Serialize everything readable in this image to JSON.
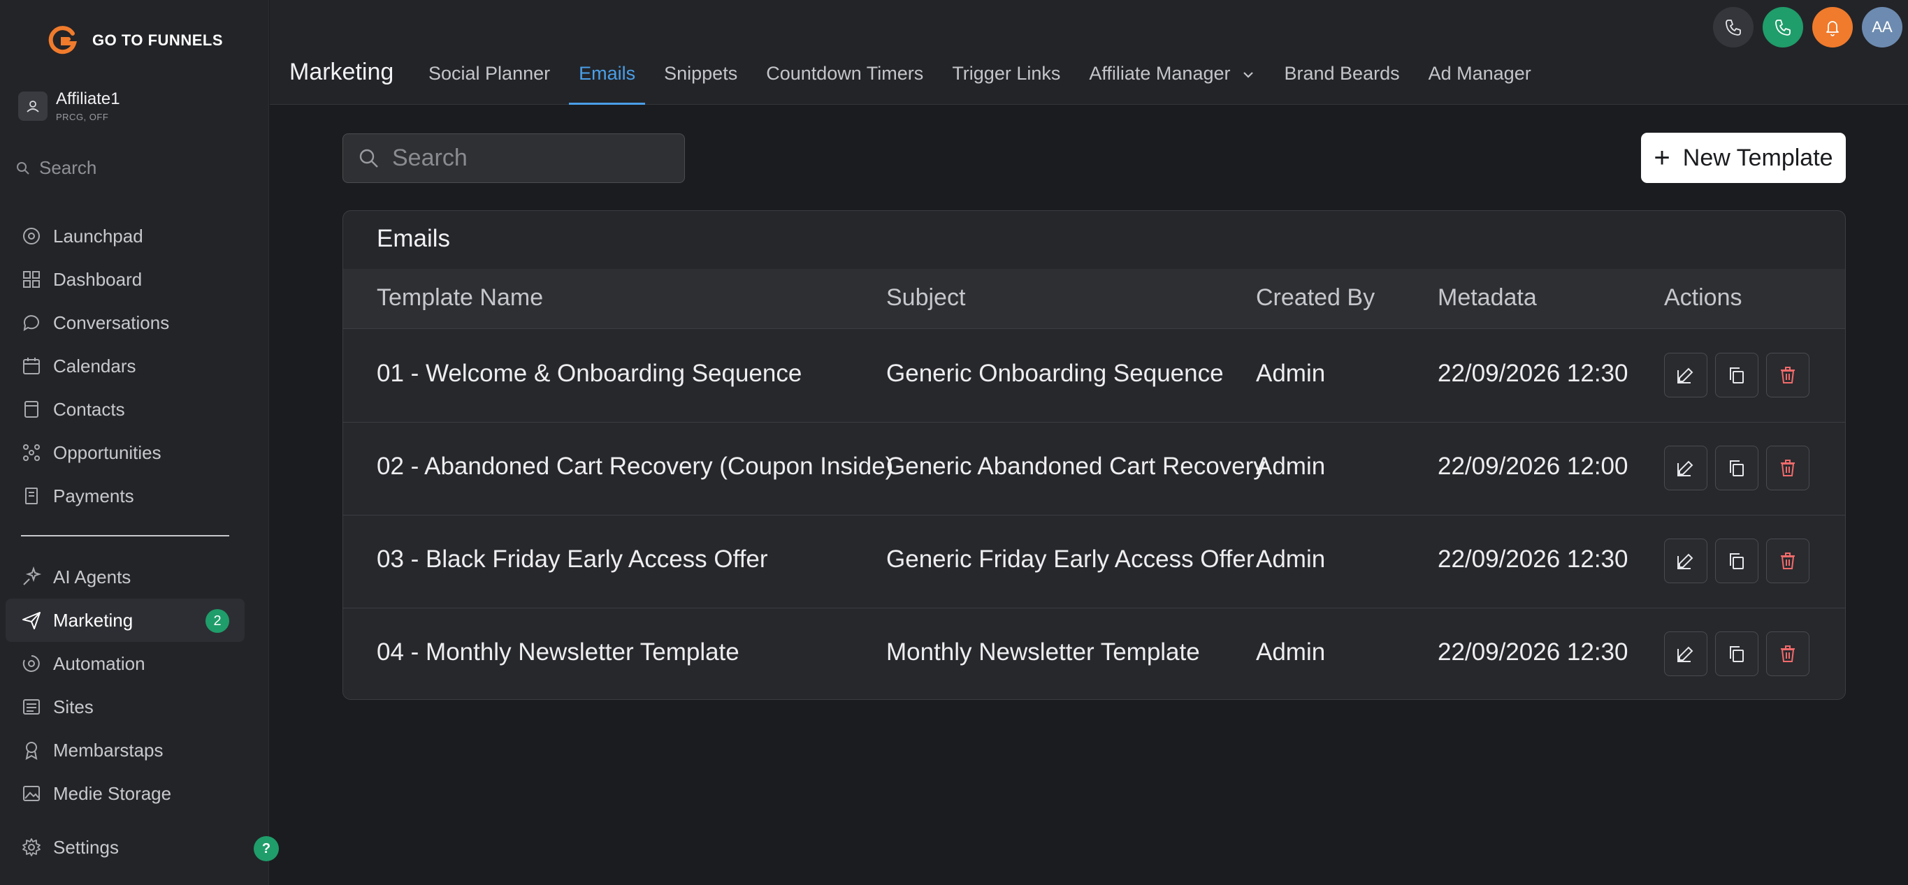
{
  "brand": {
    "name": "GO TO FUNNELS",
    "accent": "#f07b2c"
  },
  "account": {
    "name": "Affiliate1",
    "sub": "PRCG, OFF"
  },
  "sidebar": {
    "search_placeholder": "Search",
    "items": [
      {
        "label": "Launchpad",
        "icon": "launchpad-icon"
      },
      {
        "label": "Dashboard",
        "icon": "dashboard-icon"
      },
      {
        "label": "Conversations",
        "icon": "chat-icon"
      },
      {
        "label": "Calendars",
        "icon": "calendar-icon"
      },
      {
        "label": "Contacts",
        "icon": "contacts-icon"
      },
      {
        "label": "Opportunities",
        "icon": "opportunities-icon"
      },
      {
        "label": "Payments",
        "icon": "payments-icon"
      },
      {
        "label": "AI Agents",
        "icon": "sparkle-icon"
      },
      {
        "label": "Marketing",
        "icon": "send-icon",
        "badge": "2"
      },
      {
        "label": "Automation",
        "icon": "automation-icon"
      },
      {
        "label": "Sites",
        "icon": "sites-icon"
      },
      {
        "label": "Membarstaps",
        "icon": "membership-icon"
      },
      {
        "label": "Medie Storage",
        "icon": "media-icon"
      },
      {
        "label": "Settings",
        "icon": "gear-icon"
      }
    ],
    "help": "?"
  },
  "header": {
    "title": "Marketing",
    "tabs": [
      {
        "label": "Social Planner"
      },
      {
        "label": "Emails"
      },
      {
        "label": "Snippets"
      },
      {
        "label": "Countdown Timers"
      },
      {
        "label": "Trigger Links"
      },
      {
        "label": "Affiliate Manager"
      },
      {
        "label": "Brand Beards"
      },
      {
        "label": "Ad Manager"
      }
    ],
    "avatar": "AA"
  },
  "main": {
    "search_placeholder": "Search",
    "new_button": "New Template",
    "card_title": "Emails",
    "columns": [
      "Template Name",
      "Subject",
      "Created By",
      "Metadata",
      "Actions"
    ],
    "rows": [
      {
        "name": "01 - Welcome & Onboarding Sequence",
        "subject": "Generic Onboarding Sequence",
        "created_by": "Admin",
        "meta": "22/09/2026 12:30"
      },
      {
        "name": "02 - Abandoned Cart Recovery (Coupon Inside)",
        "subject": "Generic Abandoned Cart Recovery",
        "created_by": "Admin",
        "meta": "22/09/2026 12:00"
      },
      {
        "name": "03 - Black Friday Early Access Offer",
        "subject": "Generic Friday Early Access Offer",
        "created_by": "Admin",
        "meta": "22/09/2026 12:30"
      },
      {
        "name": "04 - Monthly Newsletter Template",
        "subject": "Monthly Newsletter Template",
        "created_by": "Admin",
        "meta": "22/09/2026 12:30"
      }
    ]
  }
}
